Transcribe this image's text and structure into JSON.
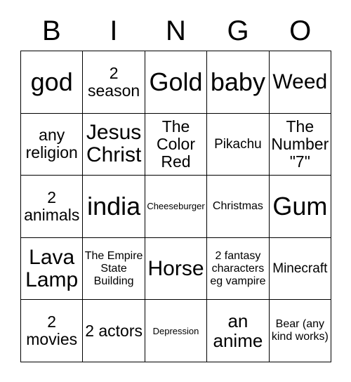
{
  "card": {
    "header": [
      "B",
      "I",
      "N",
      "G",
      "O"
    ],
    "rows": [
      [
        {
          "text": "god",
          "size": "fs-xxl"
        },
        {
          "text": "2 season",
          "size": "fs-md"
        },
        {
          "text": "Gold",
          "size": "fs-xxl"
        },
        {
          "text": "baby",
          "size": "fs-xxl"
        },
        {
          "text": "Weed",
          "size": "fs-xl"
        }
      ],
      [
        {
          "text": "any religion",
          "size": "fs-md"
        },
        {
          "text": "Jesus Christ",
          "size": "fs-xl"
        },
        {
          "text": "The Color Red",
          "size": "fs-md"
        },
        {
          "text": "Pikachu",
          "size": "fs-sm"
        },
        {
          "text": "The Number \"7\"",
          "size": "fs-md"
        }
      ],
      [
        {
          "text": "2 animals",
          "size": "fs-md"
        },
        {
          "text": "india",
          "size": "fs-xxl"
        },
        {
          "text": "Cheeseburger",
          "size": "fs-xxs"
        },
        {
          "text": "Christmas",
          "size": "fs-xs"
        },
        {
          "text": "Gum",
          "size": "fs-xxl"
        }
      ],
      [
        {
          "text": "Lava Lamp",
          "size": "fs-xl"
        },
        {
          "text": "The Empire State Building",
          "size": "fs-xs"
        },
        {
          "text": "Horse",
          "size": "fs-xl"
        },
        {
          "text": "2 fantasy characters eg vampire",
          "size": "fs-xs"
        },
        {
          "text": "Minecraft",
          "size": "fs-sm"
        }
      ],
      [
        {
          "text": "2 movies",
          "size": "fs-md"
        },
        {
          "text": "2 actors",
          "size": "fs-md"
        },
        {
          "text": "Depression",
          "size": "fs-xxs"
        },
        {
          "text": "an anime",
          "size": "fs-lg"
        },
        {
          "text": "Bear (any kind works)",
          "size": "fs-xs"
        }
      ]
    ]
  }
}
